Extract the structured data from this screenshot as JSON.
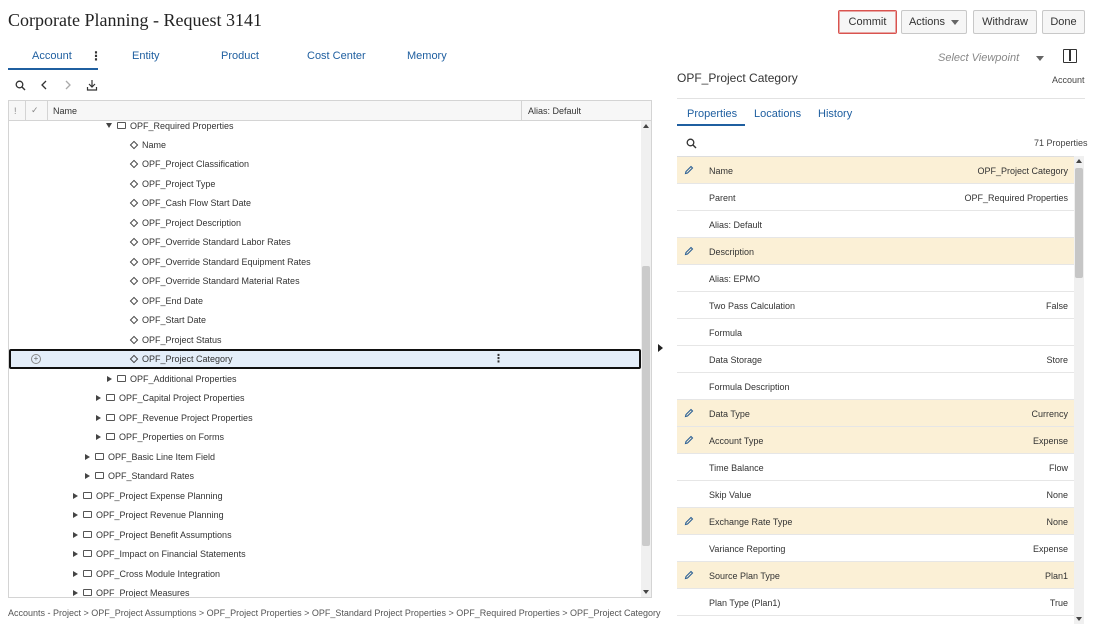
{
  "title": "Corporate Planning - Request 3141",
  "buttons": {
    "commit": "Commit",
    "actions": "Actions",
    "withdraw": "Withdraw",
    "done": "Done"
  },
  "tabs": [
    "Account",
    "Entity",
    "Product",
    "Cost Center",
    "Memory"
  ],
  "grid": {
    "columns": {
      "name": "Name",
      "alias": "Alias: Default"
    },
    "rows": [
      {
        "label": "OPF_Required Properties",
        "kind": "folder",
        "expand": "down"
      },
      {
        "label": "Name",
        "kind": "member"
      },
      {
        "label": "OPF_Project Classification",
        "kind": "member"
      },
      {
        "label": "OPF_Project Type",
        "kind": "member"
      },
      {
        "label": "OPF_Cash Flow Start Date",
        "kind": "member"
      },
      {
        "label": "OPF_Project Description",
        "kind": "member"
      },
      {
        "label": "OPF_Override Standard Labor Rates",
        "kind": "member"
      },
      {
        "label": "OPF_Override Standard Equipment Rates",
        "kind": "member"
      },
      {
        "label": "OPF_Override Standard Material Rates",
        "kind": "member"
      },
      {
        "label": "OPF_End Date",
        "kind": "member"
      },
      {
        "label": "OPF_Start Date",
        "kind": "member"
      },
      {
        "label": "OPF_Project Status",
        "kind": "member"
      },
      {
        "label": "OPF_Project Category",
        "kind": "member",
        "selected": true
      },
      {
        "label": "OPF_Additional Properties",
        "kind": "folder",
        "expand": "right"
      },
      {
        "label": "OPF_Capital Project Properties",
        "kind": "folder",
        "expand": "right"
      },
      {
        "label": "OPF_Revenue Project Properties",
        "kind": "folder",
        "expand": "right"
      },
      {
        "label": "OPF_Properties on Forms",
        "kind": "folder",
        "expand": "right"
      },
      {
        "label": "OPF_Basic Line Item Field",
        "kind": "folder",
        "expand": "right"
      },
      {
        "label": "OPF_Standard Rates",
        "kind": "folder",
        "expand": "right"
      },
      {
        "label": "OPF_Project Expense Planning",
        "kind": "folder",
        "expand": "right"
      },
      {
        "label": "OPF_Project Revenue Planning",
        "kind": "folder",
        "expand": "right"
      },
      {
        "label": "OPF_Project Benefit Assumptions",
        "kind": "folder",
        "expand": "right"
      },
      {
        "label": "OPF_Impact on Financial Statements",
        "kind": "folder",
        "expand": "right"
      },
      {
        "label": "OPF_Cross Module Integration",
        "kind": "folder",
        "expand": "right"
      },
      {
        "label": "OPF_Project Measures",
        "kind": "folder",
        "expand": "right"
      }
    ]
  },
  "breadcrumb": "Accounts - Project > OPF_Project Assumptions > OPF_Project Properties > OPF_Standard Project Properties > OPF_Required Properties > OPF_Project Category",
  "viewpoint": {
    "placeholder": "Select Viewpoint"
  },
  "panel": {
    "title": "OPF_Project Category",
    "dimension": "Account",
    "tabs": [
      "Properties",
      "Locations",
      "History"
    ],
    "count": "71 Properties",
    "properties": [
      {
        "label": "Name",
        "value": "OPF_Project Category",
        "editable": true
      },
      {
        "label": "Parent",
        "value": "OPF_Required Properties",
        "editable": false
      },
      {
        "label": "Alias: Default",
        "value": "",
        "editable": false
      },
      {
        "label": "Description",
        "value": "",
        "editable": true
      },
      {
        "label": "Alias: EPMO",
        "value": "",
        "editable": false
      },
      {
        "label": "Two Pass Calculation",
        "value": "False",
        "editable": false
      },
      {
        "label": "Formula",
        "value": "",
        "editable": false
      },
      {
        "label": "Data Storage",
        "value": "Store",
        "editable": false
      },
      {
        "label": "Formula Description",
        "value": "",
        "editable": false
      },
      {
        "label": "Data Type",
        "value": "Currency",
        "editable": true
      },
      {
        "label": "Account Type",
        "value": "Expense",
        "editable": true
      },
      {
        "label": "Time Balance",
        "value": "Flow",
        "editable": false
      },
      {
        "label": "Skip Value",
        "value": "None",
        "editable": false
      },
      {
        "label": "Exchange Rate Type",
        "value": "None",
        "editable": true
      },
      {
        "label": "Variance Reporting",
        "value": "Expense",
        "editable": false
      },
      {
        "label": "Source Plan Type",
        "value": "Plan1",
        "editable": true
      },
      {
        "label": "Plan Type (Plan1)",
        "value": "True",
        "editable": false
      }
    ]
  },
  "colors": {
    "accent": "#1f5fa0",
    "highlight_row": "#fbf0d6",
    "selected_row": "#e4eef9",
    "commit_border": "#d9534f"
  }
}
